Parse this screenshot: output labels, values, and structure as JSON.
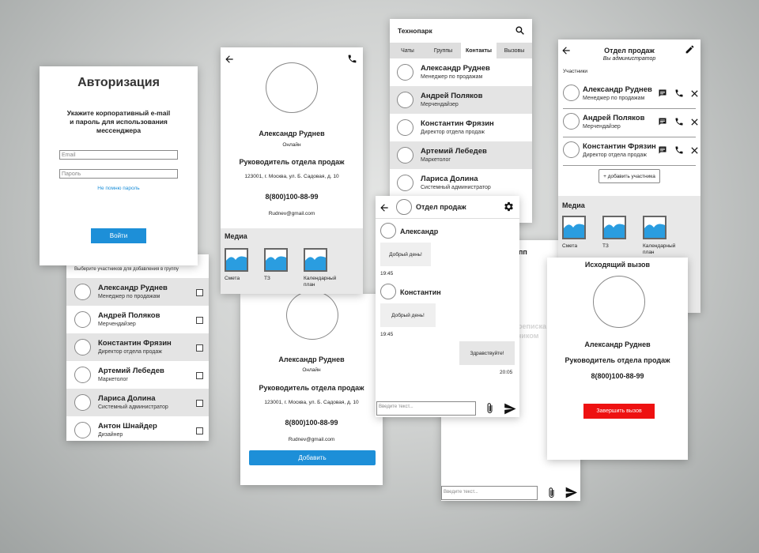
{
  "colors": {
    "accent": "#1d8fd8",
    "danger": "#ee1111",
    "gray_band": "#e4e4e4"
  },
  "auth": {
    "title": "Авторизация",
    "prompt": "Укажите корпоративный e-mail\nи пароль для использования\nмессенджера",
    "email_placeholder": "Email",
    "password_placeholder": "Пароль",
    "forgot": "Не помню пароль",
    "login": "Войти"
  },
  "select_group": {
    "hint": "Выберите участников для добавления в группу",
    "items": [
      {
        "name": "Александр Руднев",
        "role": "Менеджер по продажам"
      },
      {
        "name": "Андрей Поляков",
        "role": "Мерчендайзер"
      },
      {
        "name": "Константин Фрязин",
        "role": "Директор отдела продаж"
      },
      {
        "name": "Артемий Лебедев",
        "role": "Маркетолог"
      },
      {
        "name": "Лариса Долина",
        "role": "Системный администратор"
      },
      {
        "name": "Антон Шнайдер",
        "role": "Дизайнер"
      }
    ]
  },
  "profile": {
    "name": "Александр Руднев",
    "status": "Онлайн",
    "position": "Руководитель отдела продаж",
    "address": "123001, г. Москва, ул. Б. Садовая, д. 10",
    "phone": "8(800)100-88-99",
    "email": "Rudnev@gmail.com",
    "media_title": "Медиа",
    "media": [
      {
        "label": "Смета"
      },
      {
        "label": "ТЗ"
      },
      {
        "label": "Календарный\nплан"
      }
    ]
  },
  "profile_add": {
    "name": "Александр Руднев",
    "status": "Онлайн",
    "position": "Руководитель отдела продаж",
    "address": "123001, г. Москва, ул. Б. Садовая, д. 10",
    "phone": "8(800)100-88-99",
    "email": "Rudnev@gmail.com",
    "add_button": "Добавить"
  },
  "contacts": {
    "app_title": "Технопарк",
    "tabs": [
      {
        "label": "Чаты"
      },
      {
        "label": "Группы"
      },
      {
        "label": "Контакты"
      },
      {
        "label": "Вызовы"
      }
    ],
    "items": [
      {
        "name": "Александр Руднев",
        "role": "Менеджер по продажам"
      },
      {
        "name": "Андрей Поляков",
        "role": "Мерчендайзер"
      },
      {
        "name": "Константин Фрязин",
        "role": "Директор отдела продаж"
      },
      {
        "name": "Артемий Лебедев",
        "role": "Маркетолог"
      },
      {
        "name": "Лариса Долина",
        "role": "Системный администратор"
      }
    ]
  },
  "group_chat": {
    "title": "Отдел продаж",
    "sender1": "Александр",
    "msg1": "Добрый день!",
    "time1": "19:45",
    "sender2": "Константин",
    "msg2": "Добрый день!",
    "time2": "19:45",
    "msg3": "Здравствуйте!",
    "time3": "20:05",
    "input_placeholder": "Введите текст..."
  },
  "behind_chat": {
    "title_frag": "пп",
    "watermark1": "ерепиcка",
    "watermark2": "ником",
    "input_placeholder": "Введите текст..."
  },
  "group_info": {
    "title": "Отдел продаж",
    "subtitle": "Вы администратор",
    "members_label": "Участники",
    "members": [
      {
        "name": "Александр Руднев",
        "role": "Менеджер по продажам"
      },
      {
        "name": "Андрей Поляков",
        "role": "Мерчендайзер"
      },
      {
        "name": "Константин Фрязин",
        "role": "Директор отдела продаж"
      }
    ],
    "add_member": "+ добавить участника",
    "media_title": "Медиа",
    "media": [
      {
        "label": "Смета"
      },
      {
        "label": "ТЗ"
      },
      {
        "label": "Календарный\nплан"
      }
    ]
  },
  "call": {
    "title": "Исходящий вызов",
    "name": "Александр Руднев",
    "position": "Руководитель отдела продаж",
    "phone": "8(800)100-88-99",
    "end_button": "Завершить вызов"
  }
}
